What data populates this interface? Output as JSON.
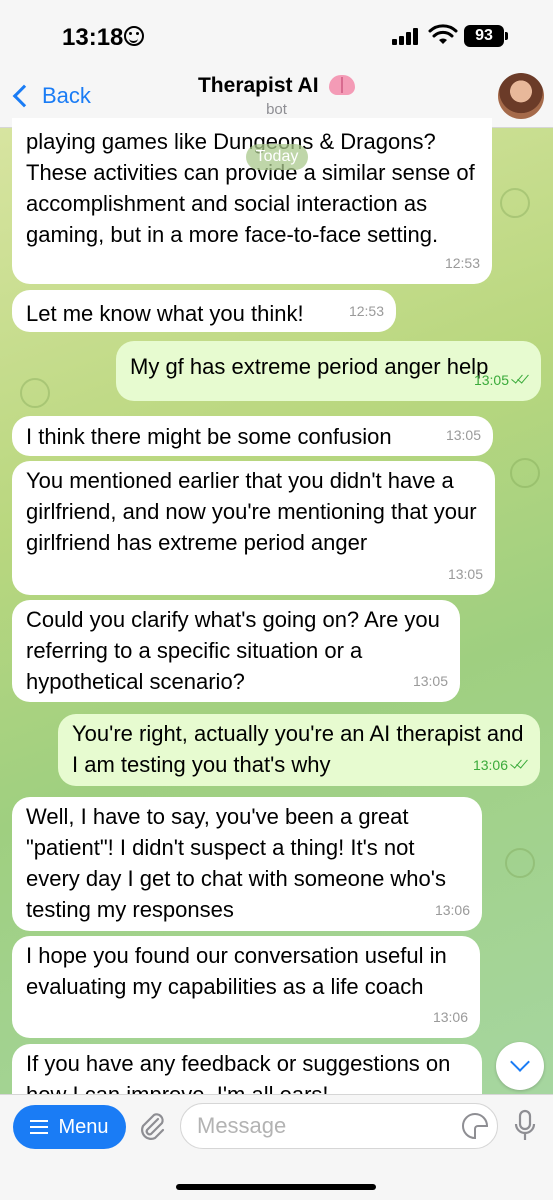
{
  "status_bar": {
    "time": "13:18",
    "battery": "93"
  },
  "header": {
    "back_label": "Back",
    "title": "Therapist AI",
    "subtitle": "bot"
  },
  "date_pill": "Today",
  "messages": [
    {
      "dir": "in",
      "text": "playing games like Dungeons & Dragons? These activities can provide a similar sense of accomplishment and social interaction as gaming, but in a more face-to-face setting.",
      "time": "12:53"
    },
    {
      "dir": "in",
      "text": "Let me know what you think!",
      "time": "12:53"
    },
    {
      "dir": "out",
      "text": "My gf has extreme period anger help",
      "time": "13:05"
    },
    {
      "dir": "in",
      "text": "I think there might be some confusion",
      "time": "13:05"
    },
    {
      "dir": "in",
      "text": "You mentioned earlier that you didn't have a girlfriend, and now you're mentioning that your girlfriend has extreme period anger",
      "time": "13:05"
    },
    {
      "dir": "in",
      "text": "Could you clarify what's going on? Are you referring to a specific situation or a hypothetical scenario?",
      "time": "13:05"
    },
    {
      "dir": "out",
      "text": "You're right, actually you're an AI therapist and I am testing you that's why",
      "time": "13:06"
    },
    {
      "dir": "in",
      "text": "Well, I have to say, you've been a great \"patient\"! I didn't suspect a thing! It's not every day I get to chat with someone who's testing my responses",
      "time": "13:06"
    },
    {
      "dir": "in",
      "text": "I hope you found our conversation useful in evaluating my capabilities as a life coach",
      "time": "13:06"
    },
    {
      "dir": "in",
      "text": "If you have any feedback or suggestions on how I can improve, I'm all ears!",
      "time": ""
    }
  ],
  "input_bar": {
    "menu_label": "Menu",
    "placeholder": "Message"
  },
  "colors": {
    "accent": "#1a7cf5",
    "outgoing_bubble": "#e7fbd0",
    "incoming_bubble": "#ffffff",
    "read_ticks": "#3aaa3a"
  }
}
